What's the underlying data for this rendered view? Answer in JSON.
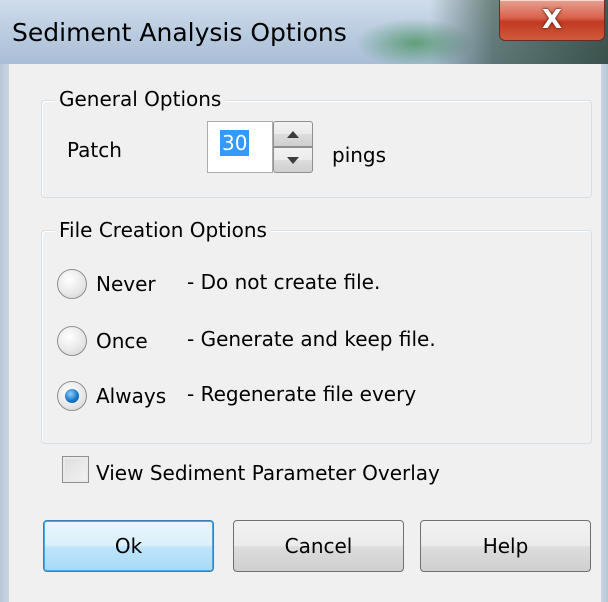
{
  "window": {
    "title": "Sediment Analysis Options",
    "close_glyph": "X"
  },
  "general": {
    "legend": "General Options",
    "patch_label": "Patch",
    "patch_value": "30",
    "unit": "pings"
  },
  "file_creation": {
    "legend": "File Creation Options",
    "options": [
      {
        "label": "Never",
        "description": "- Do not create file.",
        "selected": false
      },
      {
        "label": "Once",
        "description": "- Generate and keep file.",
        "selected": false
      },
      {
        "label": "Always",
        "description": "- Regenerate file every",
        "selected": true
      }
    ]
  },
  "overlay": {
    "label": "View Sediment Parameter Overlay",
    "checked": false
  },
  "buttons": {
    "ok": "Ok",
    "cancel": "Cancel",
    "help": "Help"
  },
  "icons": [
    "close-icon",
    "spin-up-icon",
    "spin-down-icon"
  ],
  "colors": {
    "selection": "#3399ff",
    "close_red": "#c03a22",
    "default_button": "#bee6fd"
  }
}
